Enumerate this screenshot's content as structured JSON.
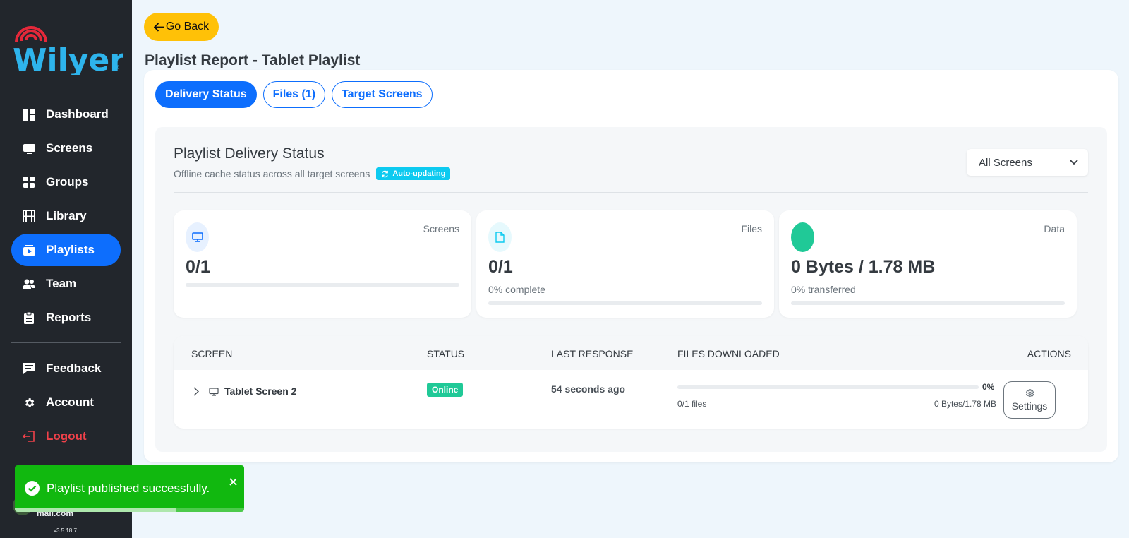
{
  "sidebar": {
    "logo_text": "Wilyer",
    "items": [
      {
        "label": "Dashboard",
        "icon": "dashboard-icon"
      },
      {
        "label": "Screens",
        "icon": "screen-icon"
      },
      {
        "label": "Groups",
        "icon": "groups-icon"
      },
      {
        "label": "Library",
        "icon": "film-icon"
      },
      {
        "label": "Playlists",
        "icon": "playlist-icon",
        "active": true
      },
      {
        "label": "Team",
        "icon": "team-icon"
      },
      {
        "label": "Reports",
        "icon": "clipboard-icon"
      }
    ],
    "bottom_items": [
      {
        "label": "Feedback",
        "icon": "feedback-icon"
      },
      {
        "label": "Account",
        "icon": "gear-icon"
      },
      {
        "label": "Logout",
        "icon": "logout-icon"
      }
    ],
    "user_email": "mail.com",
    "version": "v3.5.18.7"
  },
  "header": {
    "go_back_label": "Go Back",
    "page_title": "Playlist Report - Tablet Playlist"
  },
  "tabs": [
    {
      "label": "Delivery Status",
      "active": true
    },
    {
      "label": "Files (1)",
      "active": false
    },
    {
      "label": "Target Screens",
      "active": false
    }
  ],
  "delivery": {
    "title": "Playlist Delivery Status",
    "subtitle": "Offline cache status across all target screens",
    "auto_badge": "Auto-updating",
    "filter_value": "All Screens",
    "stats": [
      {
        "label": "Screens",
        "value": "0/1",
        "note": "",
        "progress": 0,
        "icon": "monitor-icon",
        "icon_bg": "#e7f1ff"
      },
      {
        "label": "Files",
        "value": "0/1",
        "note": "0% complete",
        "progress": 0,
        "icon": "file-icon",
        "icon_bg": "#e6f9fd"
      },
      {
        "label": "Data",
        "value": "0 Bytes / 1.78 MB",
        "note": "0% transferred",
        "progress": 0,
        "icon": "data-icon",
        "icon_bg": "#20c997"
      }
    ]
  },
  "table": {
    "headers": [
      "SCREEN",
      "STATUS",
      "LAST RESPONSE",
      "FILES DOWNLOADED",
      "ACTIONS"
    ],
    "rows": [
      {
        "screen": "Tablet Screen 2",
        "status": "Online",
        "last_response": "54 seconds ago",
        "percent": "0%",
        "progress": 0,
        "files": "0/1 files",
        "bytes": "0 Bytes/1.78 MB",
        "action": "Settings"
      }
    ]
  },
  "toast": {
    "message": "Playlist published successfully.",
    "progress": 0.7
  },
  "colors": {
    "accent": "#0d6efd",
    "warning": "#ffc107",
    "success": "#20c997",
    "toast": "#11b80f",
    "danger": "#f0414a",
    "sidebar": "#22262c"
  }
}
